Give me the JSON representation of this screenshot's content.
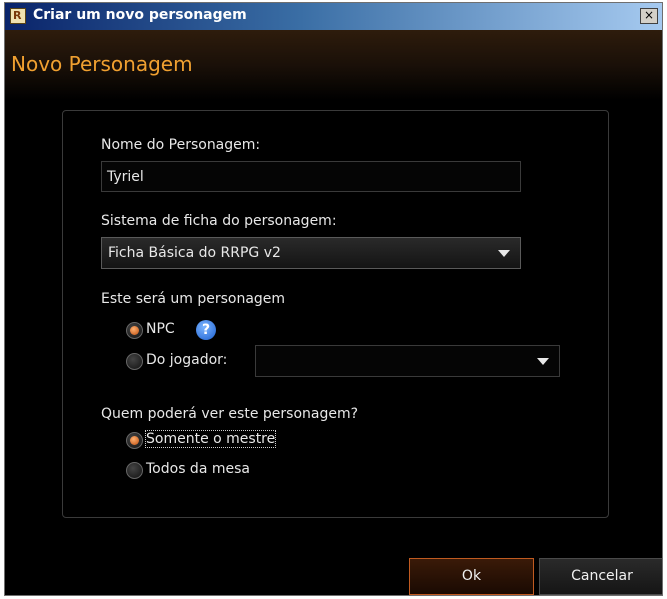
{
  "window": {
    "title": "Criar um novo personagem",
    "close_label": "×",
    "header_title": "Novo Personagem"
  },
  "form": {
    "name_label": "Nome do Personagem:",
    "name_value": "Tyriel",
    "sheet_label": "Sistema de ficha do personagem:",
    "sheet_value": "Ficha Básica do RRPG v2",
    "type_label": "Este será um personagem",
    "option_npc": "NPC",
    "option_player": "Do jogador:",
    "player_value": "",
    "visibility_label": "Quem poderá ver este personagem?",
    "option_master_only": "Somente o mestre",
    "option_all_table": "Todos da mesa",
    "help_glyph": "?"
  },
  "buttons": {
    "ok": "Ok",
    "cancel": "Cancelar"
  },
  "colors": {
    "header_text": "#f0a030",
    "accent": "#c05a20"
  }
}
